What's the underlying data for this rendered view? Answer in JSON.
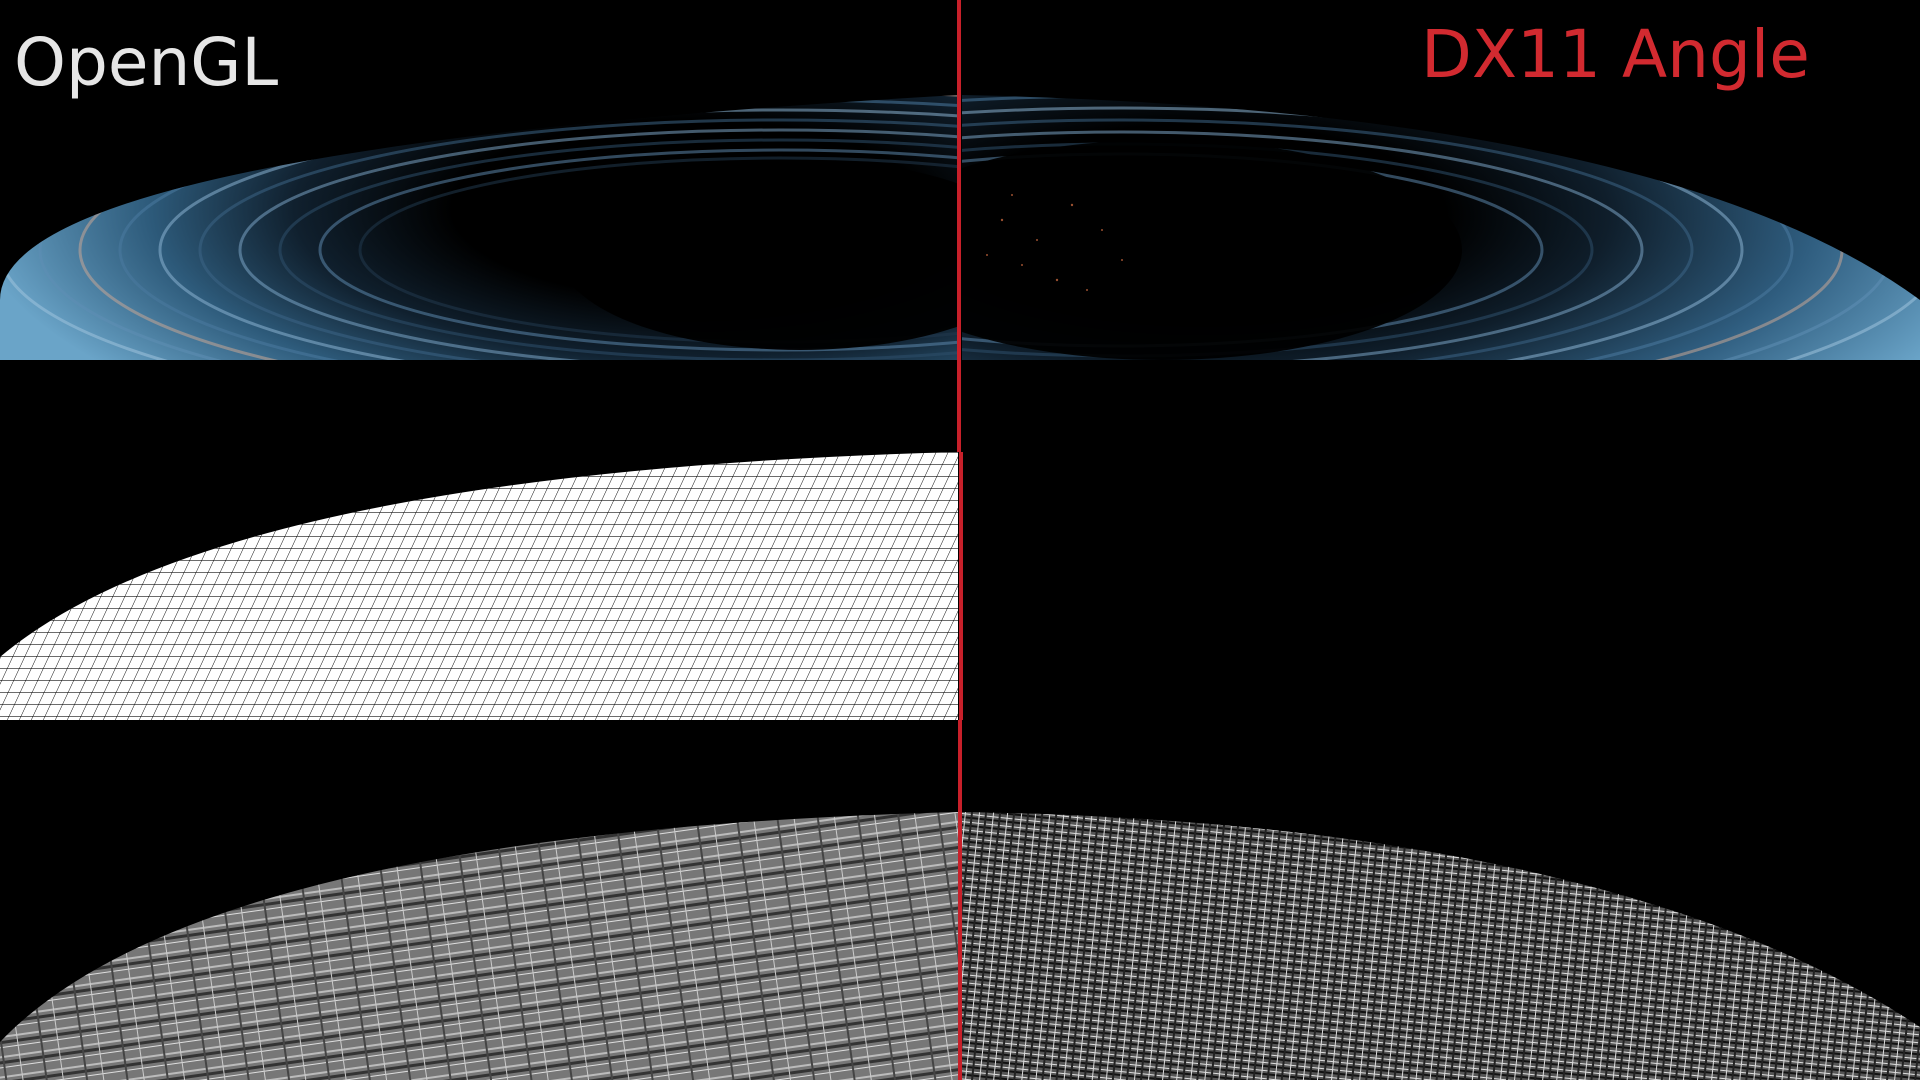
{
  "labels": {
    "left": "OpenGL",
    "right": "DX11 Angle"
  },
  "colors": {
    "background": "#000000",
    "left_label": "#e6e6e6",
    "right_label": "#d22a30",
    "divider": "#c8202a"
  }
}
